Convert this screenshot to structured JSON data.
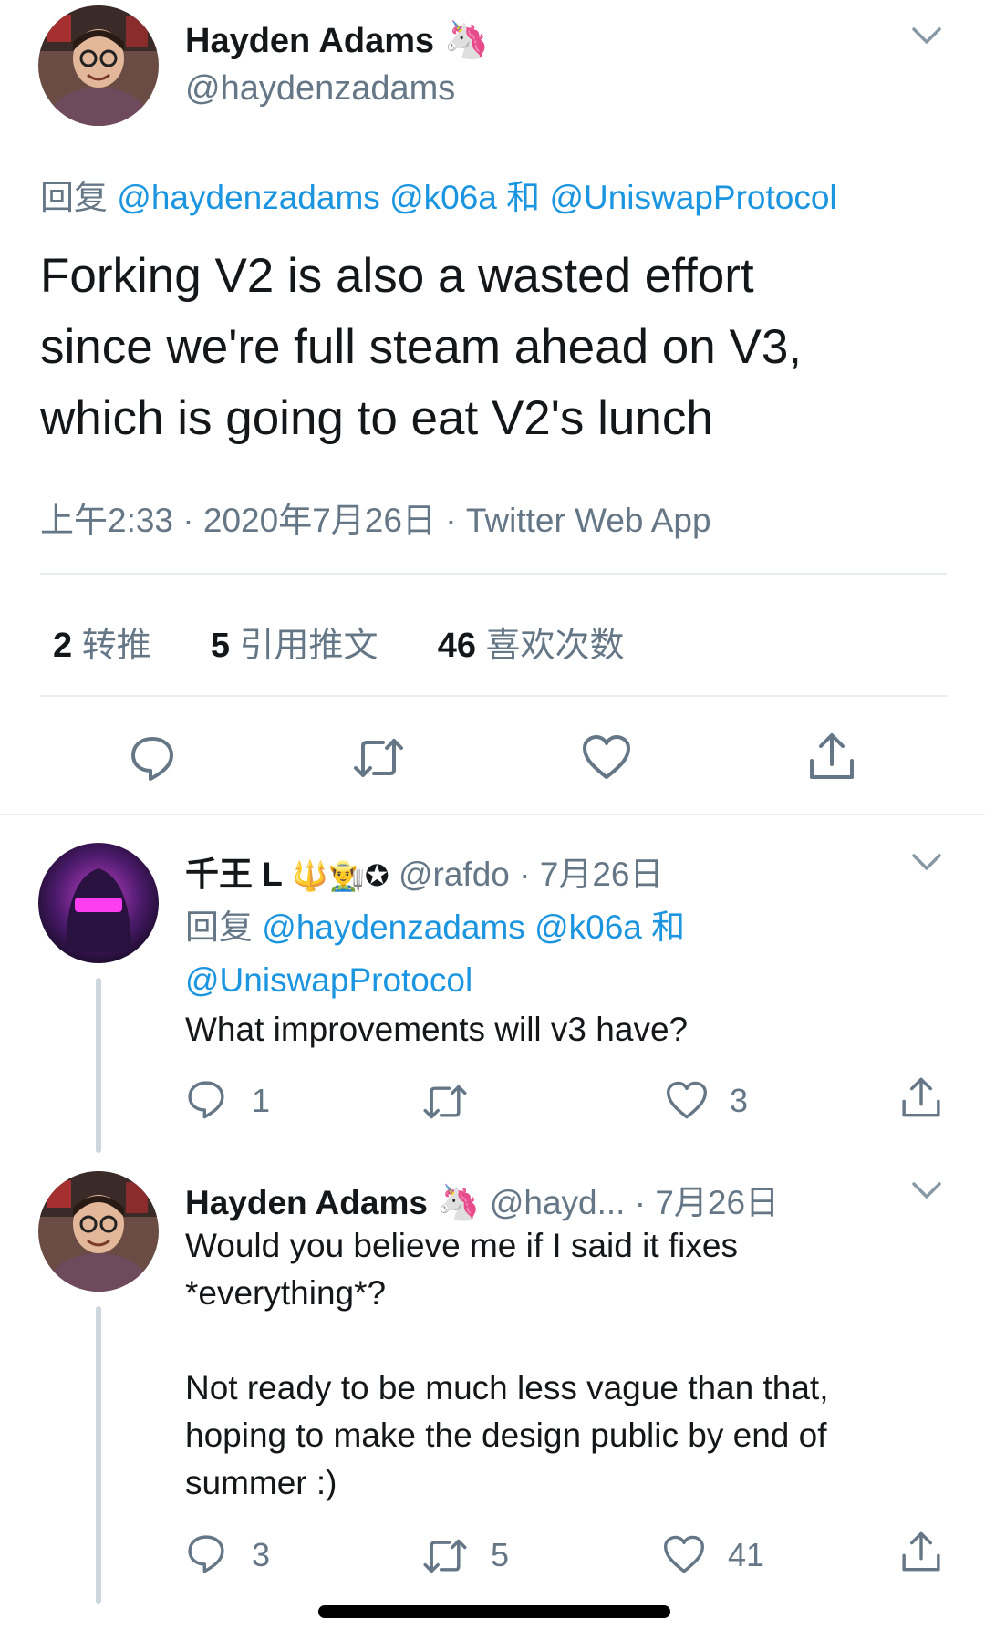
{
  "main_tweet": {
    "name": "Hayden Adams",
    "handle": "@haydenzadams",
    "reply_prefix": "回复",
    "reply_to_1": "@haydenzadams",
    "reply_to_2": "@k06a",
    "reply_and": "和",
    "reply_to_3": "@UniswapProtocol",
    "text_line1": "Forking V2 is also a wasted effort",
    "text_line2": "since we're full steam ahead on V3,",
    "text_line3": "which is going to eat V2's lunch",
    "time": "上午2:33",
    "dot1": "·",
    "date": "2020年7月26日",
    "dot2": "·",
    "source": "Twitter Web App",
    "stats": {
      "retweets_num": "2",
      "retweets_label": "转推",
      "quotes_num": "5",
      "quotes_label": "引用推文",
      "likes_num": "46",
      "likes_label": "喜欢次数"
    }
  },
  "reply1": {
    "name": "千王 L",
    "badge_emoji": "🔱👨‍🌾✪",
    "handle": "@rafdo",
    "dot": "·",
    "date": "7月26日",
    "reply_prefix": "回复",
    "reply_to_1": "@haydenzadams",
    "reply_to_2": "@k06a",
    "reply_and": "和",
    "reply_to_3": "@UniswapProtocol",
    "text": "What improvements will v3 have?",
    "reply_count": "1",
    "retweet_count": "",
    "like_count": "3"
  },
  "reply2": {
    "name": "Hayden Adams",
    "handle": "@hayd...",
    "dot": "·",
    "date": "7月26日",
    "text_line1": "Would you believe me if I said it fixes",
    "text_line2": "*everything*?",
    "text_line3": "Not ready to be much less vague than that,",
    "text_line4": "hoping to make the design public by end of",
    "text_line5": "summer :)",
    "reply_count": "3",
    "retweet_count": "5",
    "like_count": "41"
  },
  "colors": {
    "link": "#1b95e0",
    "secondary": "#657786",
    "divider": "#e6ecf0"
  }
}
